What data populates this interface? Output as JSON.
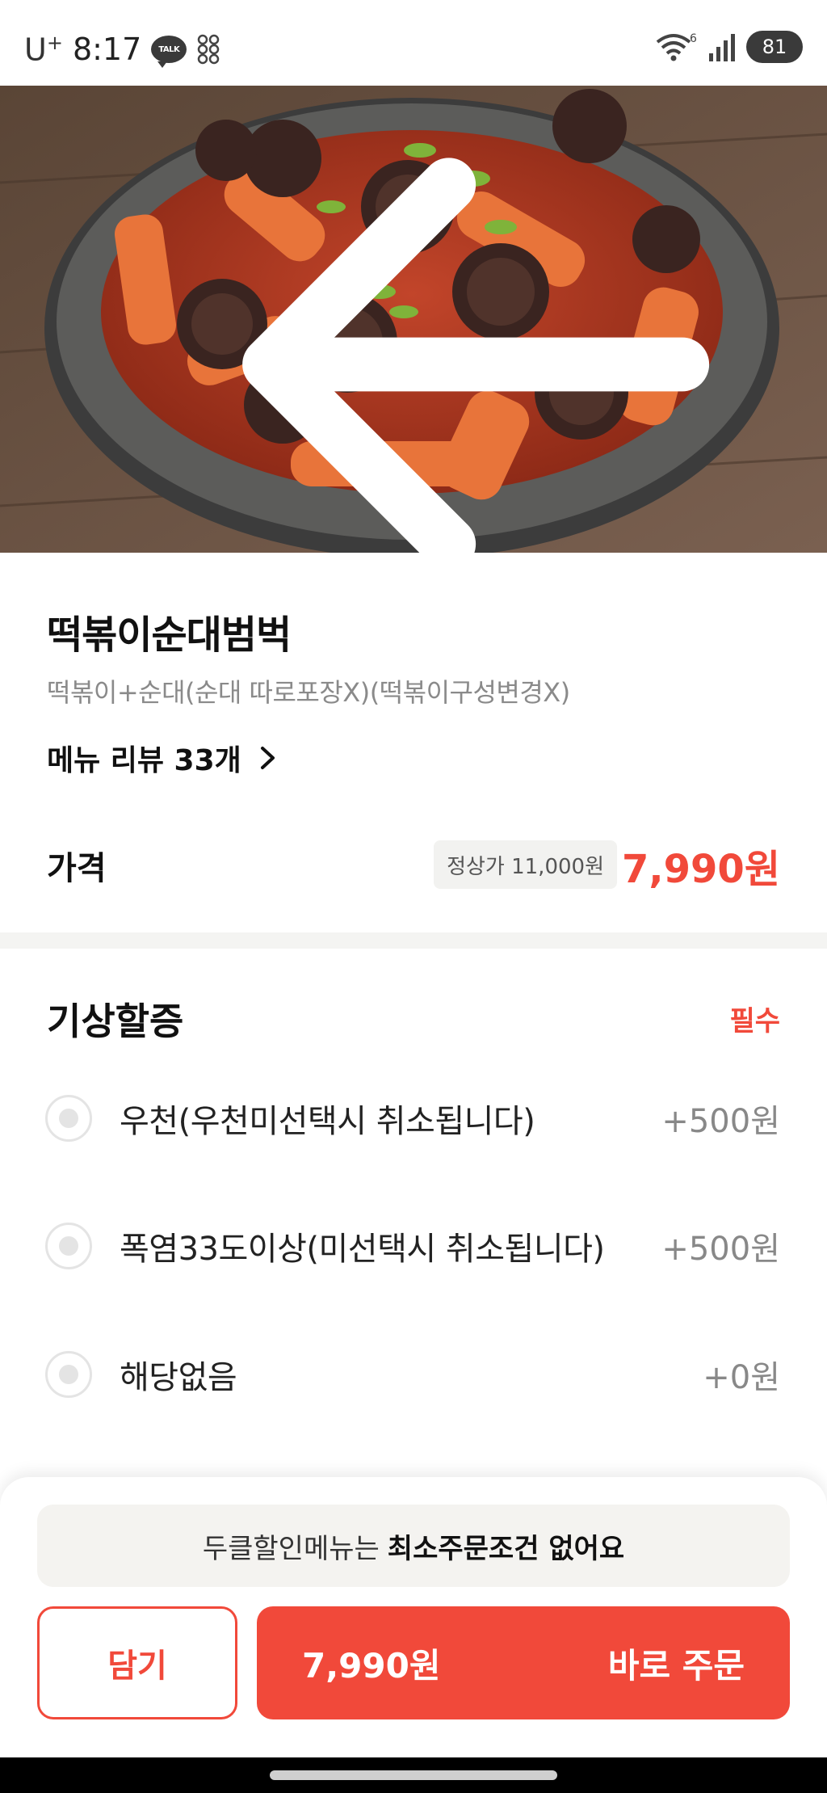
{
  "status_bar": {
    "carrier": "U",
    "carrier_plus": "+",
    "time": "8:17",
    "talk_badge": "TALK",
    "battery": "81",
    "network_badge": "6"
  },
  "menu": {
    "title": "떡볶이순대범벅",
    "description": "떡볶이+순대(순대 따로포장X)(떡볶이구성변경X)",
    "review_link": "메뉴 리뷰 33개",
    "price_label": "가격",
    "original_price": "정상가 11,000원",
    "sale_price": "7,990원"
  },
  "option_group": {
    "title": "기상할증",
    "required_badge": "필수",
    "options": [
      {
        "label": "우천(우천미선택시 취소됩니다)",
        "price": "+500원"
      },
      {
        "label": "폭염33도이상(미선택시 취소됩니다)",
        "price": "+500원"
      },
      {
        "label": "해당없음",
        "price": "+0원"
      }
    ]
  },
  "bottom": {
    "notice_prefix": "두클할인메뉴는",
    "notice_bold": "최소주문조건 없어요",
    "cart_label": "담기",
    "order_price": "7,990원",
    "order_label": "바로 주문"
  },
  "colors": {
    "accent": "#f1493a",
    "muted_text": "#8a8a8a",
    "notice_bg": "#f4f3f0"
  },
  "icons": {
    "back": "arrow-left-icon",
    "review_chevron": "chevron-right-icon",
    "wifi": "wifi-icon",
    "signal": "signal-icon",
    "battery": "battery-icon",
    "talk": "kakao-talk-icon"
  }
}
